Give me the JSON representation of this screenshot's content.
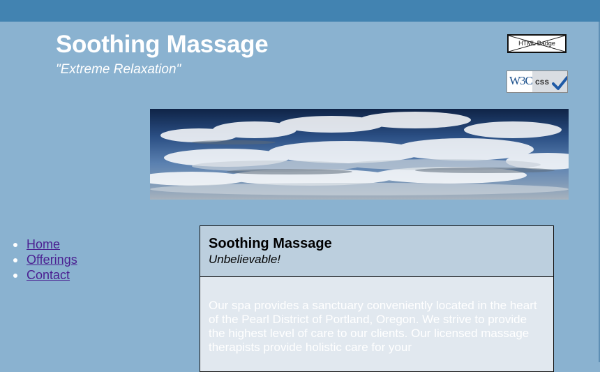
{
  "header": {
    "title": "Soothing Massage",
    "tagline": "\"Extreme Relaxation\""
  },
  "badges": {
    "html_label": "HTML Badge",
    "css_w3c": "W3C",
    "css_label": "css"
  },
  "nav": {
    "items": [
      {
        "label": "Home"
      },
      {
        "label": "Offerings"
      },
      {
        "label": "Contact"
      }
    ]
  },
  "main": {
    "title": "Soothing Massage",
    "subtitle": "Unbelievable!",
    "body": "Our spa provides a sanctuary conveniently located in the heart of the Pearl District of Portland, Oregon. We strive to provide the highest level of care to our clients. Our licensed massage therapists provide holistic care for your"
  },
  "colors": {
    "page_background": "#8ab2d0",
    "top_bar": "#4283b1",
    "link": "#4a1f91",
    "content_header": "#bccfde",
    "content_body": "#e1e8ef"
  },
  "icons": {
    "banner": "sky-clouds-image",
    "html_badge": "html-badge-placeholder",
    "css_badge": "w3c-css-checkmark"
  }
}
